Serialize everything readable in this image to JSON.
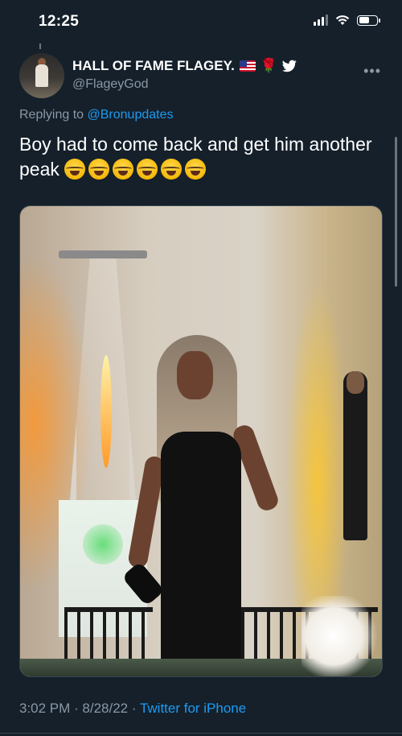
{
  "status_bar": {
    "time": "12:25",
    "battery_level": 0.6
  },
  "tweet": {
    "author": {
      "display_name": "HALL OF FAME FLAGEY.",
      "handle": "@FlageyGod",
      "badges": [
        "us-flag-icon",
        "rose-icon",
        "twitter-bird-icon"
      ]
    },
    "replying_prefix": "Replying to",
    "replying_to": "@Bronupdates",
    "text": "Boy had to come back and get him another peak",
    "emoji_count": 6,
    "emoji_name": "face-with-tears-of-joy",
    "timestamp": "3:02 PM · 8/28/22 · ",
    "source": "Twitter for iPhone"
  },
  "colors": {
    "background": "#15202b",
    "accent": "#1d9bf0",
    "secondary_text": "#8b98a5",
    "border": "#38444d"
  }
}
